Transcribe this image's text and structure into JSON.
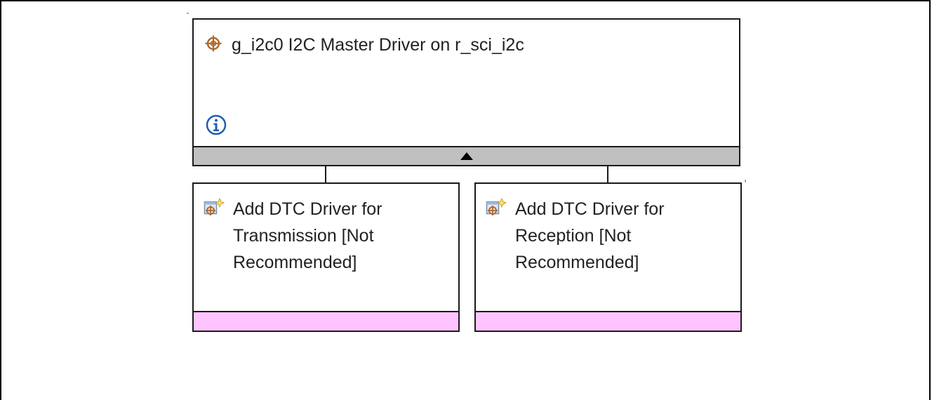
{
  "main_module": {
    "title": "g_i2c0 I2C Master Driver on r_sci_i2c",
    "icon": "target-crosshair-icon",
    "info_icon": "info-icon",
    "collapse_icon": "triangle-up-icon"
  },
  "sub_modules": [
    {
      "icon": "add-module-icon",
      "lines": [
        "Add DTC Driver for",
        "Transmission [Not",
        "Recommended]"
      ]
    },
    {
      "icon": "add-module-icon",
      "lines": [
        "Add DTC Driver for",
        "Reception [Not",
        "Recommended]"
      ]
    }
  ],
  "colors": {
    "collapse_bar": "#c0c0c0",
    "requirement_bar": "#ffc4ff",
    "icon_accent": "#b06a2c",
    "info_blue": "#1f5fae"
  }
}
